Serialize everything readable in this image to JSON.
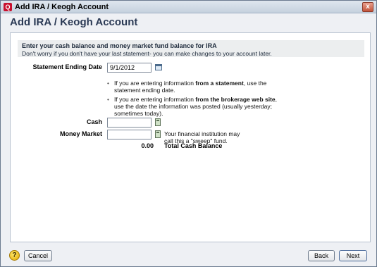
{
  "window": {
    "title": "Add IRA / Keogh Account",
    "icon": "quicken-q-icon",
    "close_glyph": "x"
  },
  "dialog": {
    "title": "Add IRA / Keogh Account"
  },
  "banner": {
    "title": "Enter your cash balance and money market fund balance for IRA",
    "subtitle": "Don't worry if you don't have your last statement- you can make changes to your account later."
  },
  "form": {
    "statement_label": "Statement Ending Date",
    "statement_value": "9/1/2012",
    "bullet1_pre": "If you are entering information ",
    "bullet1_bold": "from a statement",
    "bullet1_post": ", use the",
    "bullet1_line2": "statement ending date.",
    "bullet2_pre": "If you are entering information ",
    "bullet2_bold": "from the brokerage web site",
    "bullet2_post": ",",
    "bullet2_line2": "use the date the information was posted (usually yesterday;",
    "bullet2_line3": "sometimes today).",
    "cash_label": "Cash",
    "cash_value": "",
    "money_market_label": "Money Market",
    "money_market_value": "",
    "sweep_note_line1": "Your financial institution may",
    "sweep_note_line2": "call this a \"sweep\" fund.",
    "total_value": "0.00",
    "total_label": "Total Cash Balance"
  },
  "footer": {
    "help_glyph": "?",
    "cancel_label": "Cancel",
    "back_label": "Back",
    "next_label": "Next"
  }
}
